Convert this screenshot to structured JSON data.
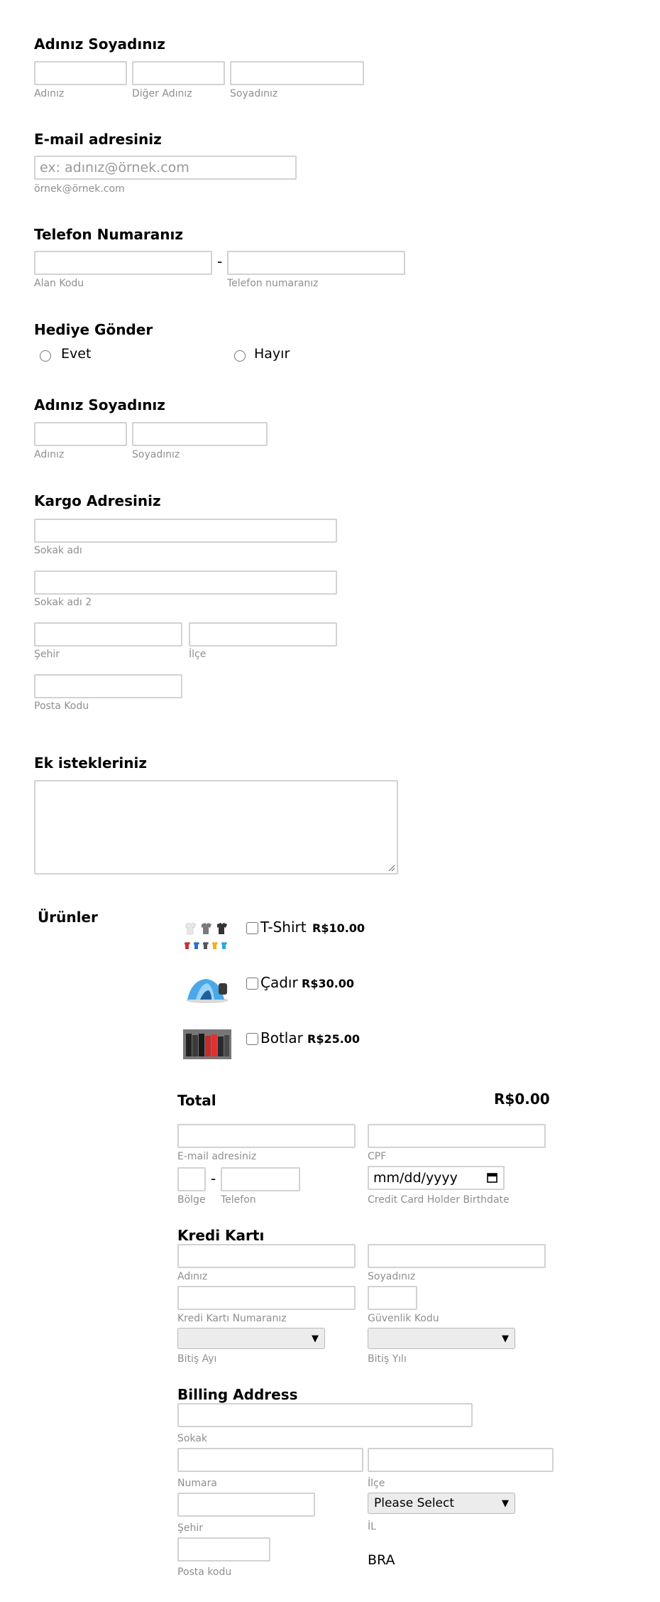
{
  "name_section": {
    "title": "Adınız Soyadınız",
    "first_sub": "Adınız",
    "middle_sub": "Diğer Adınız",
    "last_sub": "Soyadınız"
  },
  "email_section": {
    "title": "E-mail adresiniz",
    "placeholder": "ex: adınız@örnek.com",
    "sub": "örnek@örnek.com"
  },
  "phone_section": {
    "title": "Telefon Numaranız",
    "dash": "-",
    "area_sub": "Alan Kodu",
    "number_sub": "Telefon numaranız"
  },
  "gift_section": {
    "title": "Hediye Gönder",
    "options": [
      "Evet",
      "Hayır"
    ]
  },
  "recipient_section": {
    "title": "Adınız Soyadınız",
    "first_sub": "Adınız",
    "last_sub": "Soyadınız"
  },
  "shipping_section": {
    "title": "Kargo Adresiniz",
    "street_sub": "Sokak adı",
    "street2_sub": "Sokak adı 2",
    "city_sub": "Şehir",
    "district_sub": "İlçe",
    "postal_sub": "Posta Kodu"
  },
  "requests_section": {
    "title": "Ek istekleriniz"
  },
  "products_section": {
    "title": "Ürünler",
    "items": [
      {
        "name": "T-Shirt",
        "price": "R$10.00",
        "image": "tshirts-image"
      },
      {
        "name": "Çadır",
        "price": "R$30.00",
        "image": "tent-image"
      },
      {
        "name": "Botlar",
        "price": "R$25.00",
        "image": "boots-image"
      }
    ],
    "total_label": "Total",
    "total_value": "R$0.00"
  },
  "payment_section": {
    "email_sub": "E-mail adresiniz",
    "cpf_sub": "CPF",
    "dash": "-",
    "region_sub": "Bölge",
    "phone_sub": "Telefon",
    "birthdate_value": "mm/dd/yyyy",
    "birthdate_sub": "Credit Card Holder Birthdate",
    "card_title": "Kredi Kartı",
    "card_first_sub": "Adınız",
    "card_last_sub": "Soyadınız",
    "card_number_sub": "Kredi Kartı Numaranız",
    "cvv_sub": "Güvenlik Kodu",
    "exp_month_sub": "Bitiş Ayı",
    "exp_year_sub": "Bitiş Yılı"
  },
  "billing_section": {
    "title": "Billing Address",
    "street_sub": "Sokak",
    "number_sub": "Numara",
    "district_sub": "İlçe",
    "city_sub": "Şehir",
    "state_select": "Please Select",
    "state_sub": "İL",
    "postal_sub": "Posta kodu",
    "country": "BRA"
  },
  "colors": {
    "border": "#d2d2d2",
    "sublabel": "#8f8f8f"
  }
}
